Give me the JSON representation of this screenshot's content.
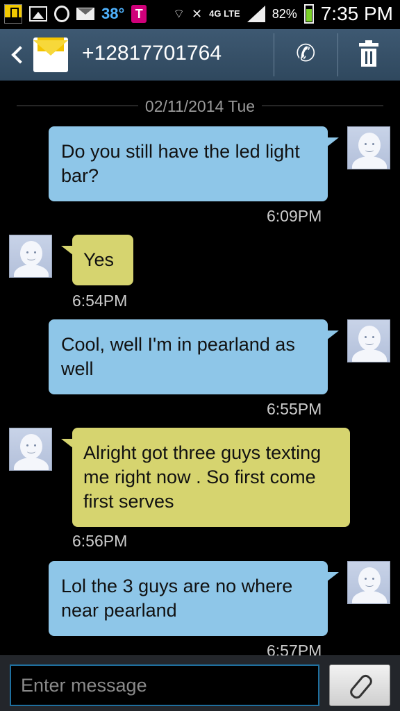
{
  "status_bar": {
    "temperature": "38°",
    "tmobile_letter": "T",
    "lte": "4G LTE",
    "battery": "82%",
    "battery_level": 0.82,
    "clock": "7:35 PM"
  },
  "header": {
    "contact_number": "+12817701764"
  },
  "conversation": {
    "date_divider": "02/11/2014 Tue",
    "messages": [
      {
        "direction": "sent",
        "text": "Do you still have the led light bar?",
        "time": "6:09PM"
      },
      {
        "direction": "received",
        "text": "Yes",
        "time": "6:54PM"
      },
      {
        "direction": "sent",
        "text": "Cool, well I'm in pearland as well",
        "time": "6:55PM"
      },
      {
        "direction": "received",
        "text": "Alright got three guys texting me right now . So first come first serves",
        "time": "6:56PM"
      },
      {
        "direction": "sent",
        "text": "Lol the 3 guys are no where near pearland",
        "time": "6:57PM"
      }
    ]
  },
  "composer": {
    "placeholder": "Enter message"
  },
  "colors": {
    "header_bg": "#2f485e",
    "sent_bubble": "#8ec6e8",
    "received_bubble": "#d6d46f",
    "input_border": "#1f6f9e"
  },
  "icons": {
    "status_left": [
      "national-geographic-icon",
      "gallery-icon",
      "drop-icon",
      "mail-icon",
      "tmobile-icon"
    ],
    "status_right": [
      "wifi-icon",
      "mute-icon",
      "lte-icon",
      "signal-icon",
      "battery-icon"
    ],
    "header": [
      "back-icon",
      "contact-envelope-icon",
      "phone-icon",
      "trash-icon"
    ],
    "composer": [
      "paperclip-icon"
    ]
  }
}
